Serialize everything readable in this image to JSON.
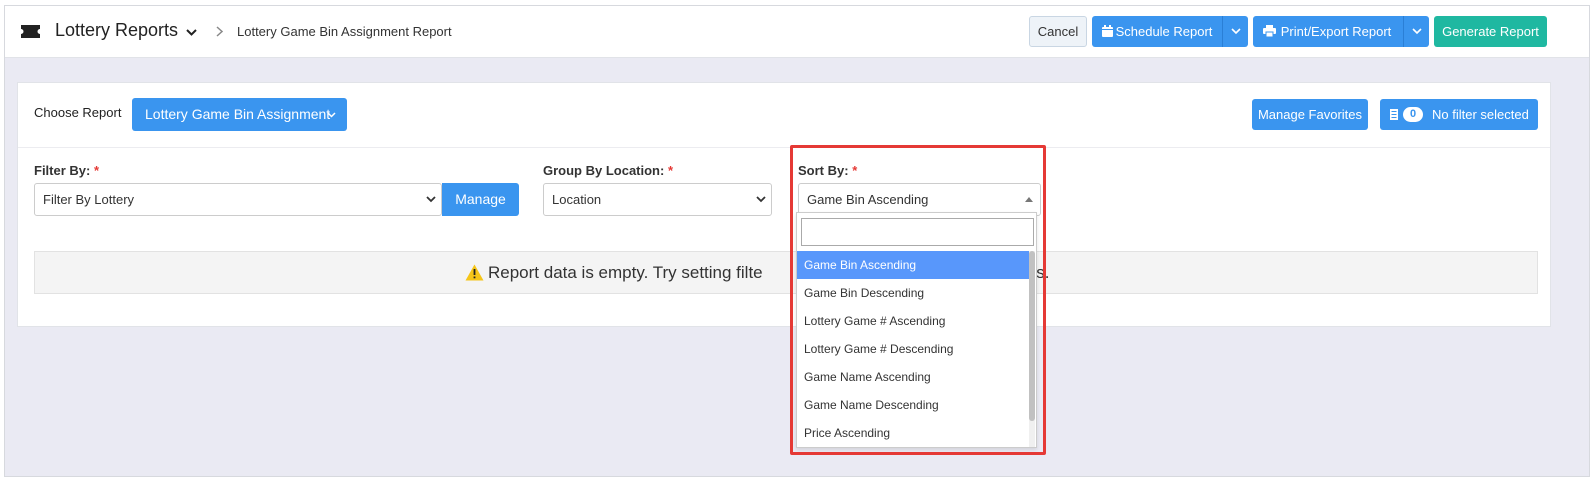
{
  "header": {
    "app_title": "Lottery Reports",
    "breadcrumb": "Lottery Game Bin Assignment Report",
    "icons": {
      "app": "ticket-icon",
      "title_menu": "chevron-down-icon",
      "separator": "chevron-right-icon"
    }
  },
  "toolbar": {
    "cancel_label": "Cancel",
    "schedule_label": "Schedule Report",
    "print_label": "Print/Export Report",
    "generate_label": "Generate Report",
    "icons": {
      "schedule": "calendar-icon",
      "print": "printer-icon"
    }
  },
  "report": {
    "choose_label": "Choose Report",
    "selected_report": "Lottery Game Bin Assignment",
    "manage_favorites_label": "Manage Favorites",
    "filter_count": "0",
    "filter_status": "No filter selected"
  },
  "filters": {
    "filter_by": {
      "label": "Filter By:",
      "required_mark": "*",
      "value": "Filter By Lottery",
      "manage_label": "Manage"
    },
    "group_by": {
      "label": "Group By Location:",
      "required_mark": "*",
      "value": "Location"
    },
    "sort_by": {
      "label": "Sort By:",
      "required_mark": "*",
      "value": "Game Bin Ascending",
      "search_value": "",
      "options": [
        "Game Bin Ascending",
        "Game Bin Descending",
        "Lottery Game # Ascending",
        "Lottery Game # Descending",
        "Game Name Ascending",
        "Game Name Descending",
        "Price Ascending"
      ],
      "active_option": "Game Bin Ascending"
    }
  },
  "empty_message": {
    "left": "Report data is empty. Try setting filte",
    "right": "results.",
    "icon": "warning-icon"
  },
  "colors": {
    "primary": "#3a95ef",
    "generate": "#1fb8a1",
    "highlight": "#e53935",
    "active_option": "#5897fb",
    "page_bg": "#eaeaf3",
    "warning": "#f5c518"
  }
}
